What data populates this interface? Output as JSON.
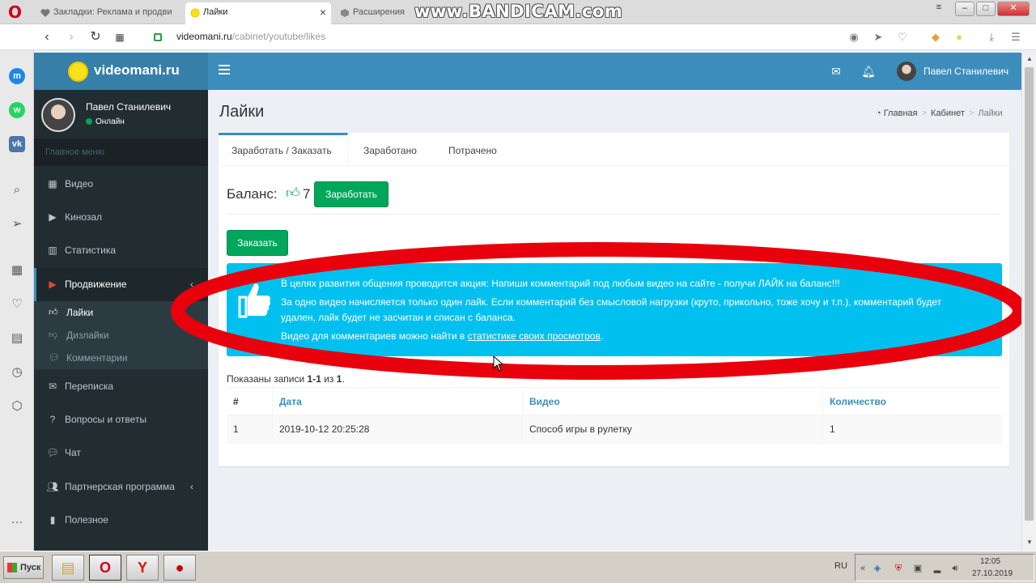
{
  "browser": {
    "tabs": [
      {
        "label": "Закладки: Реклама и продви"
      },
      {
        "label": "Лайки"
      },
      {
        "label": "Расширения"
      }
    ],
    "url_host": "videomani.ru",
    "url_path": "/cabinet/youtube/likes",
    "watermark": "www.BANDICAM.com",
    "window_controls": {
      "minimize": "–",
      "maximize": "□",
      "close": "✕"
    }
  },
  "site": {
    "logo_text": "videomani.ru",
    "user_name": "Павел Станилевич",
    "status": "Онлайн",
    "menu_header": "Главное меню",
    "menu": [
      {
        "label": "Видео",
        "icon": "film-icon"
      },
      {
        "label": "Кинозал",
        "icon": "play-circle-icon"
      },
      {
        "label": "Статистика",
        "icon": "bar-chart-icon"
      },
      {
        "label": "Продвижение",
        "icon": "youtube-icon"
      },
      {
        "label": "Переписка",
        "icon": "envelope-icon"
      },
      {
        "label": "Вопросы и ответы",
        "icon": "question-circle-icon"
      },
      {
        "label": "Чат",
        "icon": "comments-icon"
      },
      {
        "label": "Партнерская программа",
        "icon": "users-icon"
      },
      {
        "label": "Полезное",
        "icon": "book-icon"
      }
    ],
    "submenu": [
      {
        "label": "Лайки"
      },
      {
        "label": "Дизлайки"
      },
      {
        "label": "Комментарии"
      }
    ],
    "header_user": "Павел Станилевич"
  },
  "page": {
    "title": "Лайки",
    "breadcrumb": [
      "Главная",
      "Кабинет",
      "Лайки"
    ],
    "tabs": [
      "Заработать / Заказать",
      "Заработано",
      "Потрачено"
    ],
    "balance_label": "Баланс:",
    "balance_value": "7",
    "earn_button": "Заработать",
    "order_button": "Заказать",
    "callout": {
      "line1": "В целях развития общения проводится акция: Напиши комментарий под любым видео на сайте - получи ЛАЙК на баланс!!!",
      "line2": "За одно видео начисляется только один лайк. Если комментарий без смысловой нагрузки (круто, прикольно, тоже хочу и т.п.), комментарий будет",
      "line3": "удален, лайк будет не засчитан и списан с баланса.",
      "line4_prefix": "Видео для комментариев можно найти в ",
      "line4_link": "статистике своих просмотров",
      "line4_suffix": "."
    },
    "records": {
      "prefix": "Показаны записи ",
      "range": "1-1",
      "middle": " из ",
      "total": "1",
      "suffix": "."
    },
    "table": {
      "headers": [
        "#",
        "Дата",
        "Видео",
        "Количество"
      ],
      "rows": [
        [
          "1",
          "2019-10-12 20:25:28",
          "Способ игры в рулетку",
          "1"
        ]
      ]
    }
  },
  "taskbar": {
    "start": "Пуск",
    "lang": "RU",
    "time": "12:05",
    "date": "27.10.2019"
  },
  "colors": {
    "header_blue": "#3c8dbc",
    "logo_blue": "#367fa9",
    "sidebar_dark": "#222d32",
    "green": "#00a65a",
    "callout_cyan": "#00c0ef",
    "annotation_red": "#e8000c"
  }
}
